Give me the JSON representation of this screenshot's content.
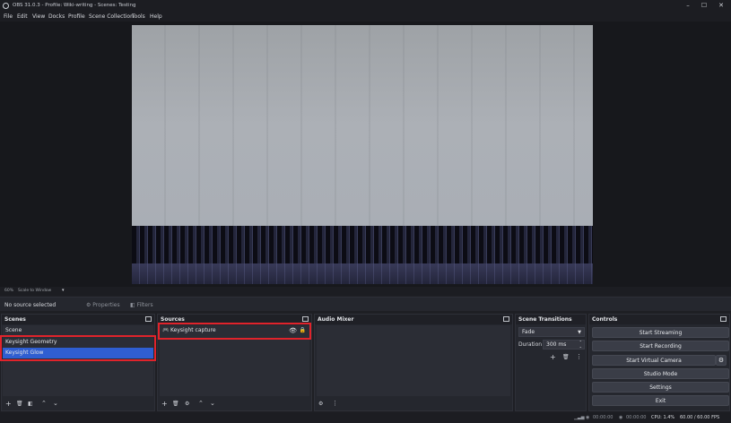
{
  "window": {
    "title": "OBS 31.0.3 - Profile: Wiki-writing - Scenes: Testing",
    "minimize": "–",
    "maximize": "☐",
    "close": "✕"
  },
  "menu": [
    "File",
    "Edit",
    "View",
    "Docks",
    "Profile",
    "Scene Collection",
    "Tools",
    "Help"
  ],
  "preview": {
    "zoom": "60%",
    "scale_mode": "Scale to Window"
  },
  "context_bar": {
    "no_source": "No source selected",
    "properties": "Properties",
    "filters": "Filters"
  },
  "scenes": {
    "title": "Scenes",
    "items": [
      {
        "label": "Scene",
        "selected": false
      },
      {
        "label": "Keysight Geometry",
        "selected": false
      },
      {
        "label": "Keysight Glow",
        "selected": true
      }
    ]
  },
  "sources": {
    "title": "Sources",
    "items": [
      {
        "label": "Keysight capture",
        "icon": "gamepad-icon"
      }
    ]
  },
  "audio_mixer": {
    "title": "Audio Mixer"
  },
  "transitions": {
    "title": "Scene Transitions",
    "selected": "Fade",
    "duration_label": "Duration",
    "duration_value": "300 ms"
  },
  "controls": {
    "title": "Controls",
    "start_streaming": "Start Streaming",
    "start_recording": "Start Recording",
    "start_virtual_camera": "Start Virtual Camera",
    "studio_mode": "Studio Mode",
    "settings": "Settings",
    "exit": "Exit"
  },
  "status": {
    "stream_time": "00:00:00",
    "record_time": "00:00:00",
    "cpu": "CPU: 1.4%",
    "fps": "60.00 / 60.00 FPS"
  },
  "colors": {
    "selection": "#2f5ed1",
    "highlight_box": "#e0232b"
  }
}
